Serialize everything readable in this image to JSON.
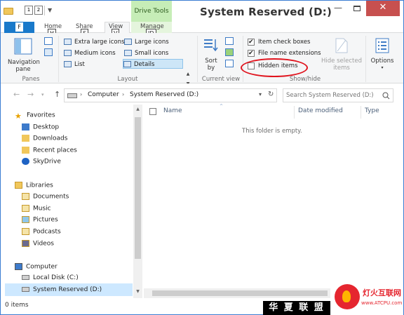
{
  "window": {
    "title": "System Reserved (D:)",
    "contextual_tab_group": "Drive Tools",
    "quick_access": [
      "1",
      "2"
    ],
    "controls": {
      "minimize": "—",
      "close": "✕"
    }
  },
  "ribbon_tabs": [
    {
      "label": "F",
      "name": "File",
      "keytip": "F"
    },
    {
      "label": "Home",
      "keytip": "H"
    },
    {
      "label": "Share",
      "keytip": "S"
    },
    {
      "label": "View",
      "keytip": "V",
      "selected": true
    },
    {
      "label": "Manage",
      "keytip": "JD"
    }
  ],
  "ribbon": {
    "panes": {
      "label": "Panes",
      "navigation_pane": "Navigation",
      "navigation_pane_2": "pane"
    },
    "layout": {
      "label": "Layout",
      "items": [
        "Extra large icons",
        "Large icons",
        "Medium icons",
        "Small icons",
        "List",
        "Details"
      ],
      "selected": "Details"
    },
    "current_view": {
      "label": "Current view",
      "sort_by_1": "Sort",
      "sort_by_2": "by"
    },
    "show_hide": {
      "label": "Show/hide",
      "item_check_boxes": "Item check boxes",
      "file_name_extensions": "File name extensions",
      "hidden_items": "Hidden items",
      "hide_selected_1": "Hide selected",
      "hide_selected_2": "items",
      "checks": {
        "item_check_boxes": true,
        "file_name_extensions": true,
        "hidden_items": false
      }
    },
    "options": {
      "label_1": "Options",
      "label_2": "▾"
    }
  },
  "address": {
    "crumbs": [
      "Computer",
      "System Reserved (D:)"
    ],
    "search_placeholder": "Search System Reserved (D:)"
  },
  "nav_pane": {
    "favorites": {
      "label": "Favorites",
      "items": [
        "Desktop",
        "Downloads",
        "Recent places",
        "SkyDrive"
      ]
    },
    "libraries": {
      "label": "Libraries",
      "items": [
        "Documents",
        "Music",
        "Pictures",
        "Podcasts",
        "Videos"
      ]
    },
    "computer": {
      "label": "Computer",
      "items": [
        "Local Disk (C:)",
        "System Reserved (D:)"
      ]
    }
  },
  "content": {
    "columns": [
      "Name",
      "Date modified",
      "Type"
    ],
    "empty_message": "This folder is empty."
  },
  "status": {
    "items_count": "0 items"
  },
  "watermark": {
    "left_text": "华 夏 联 盟",
    "site_name": "灯火互联网",
    "site_url": "www.ATCPU.com"
  },
  "colors": {
    "file_tab": "#1979ca",
    "drive_tools": "#c6edb7",
    "close_button": "#c7504f",
    "selection": "#cde8ff",
    "annotation_ring": "#e0141e"
  }
}
